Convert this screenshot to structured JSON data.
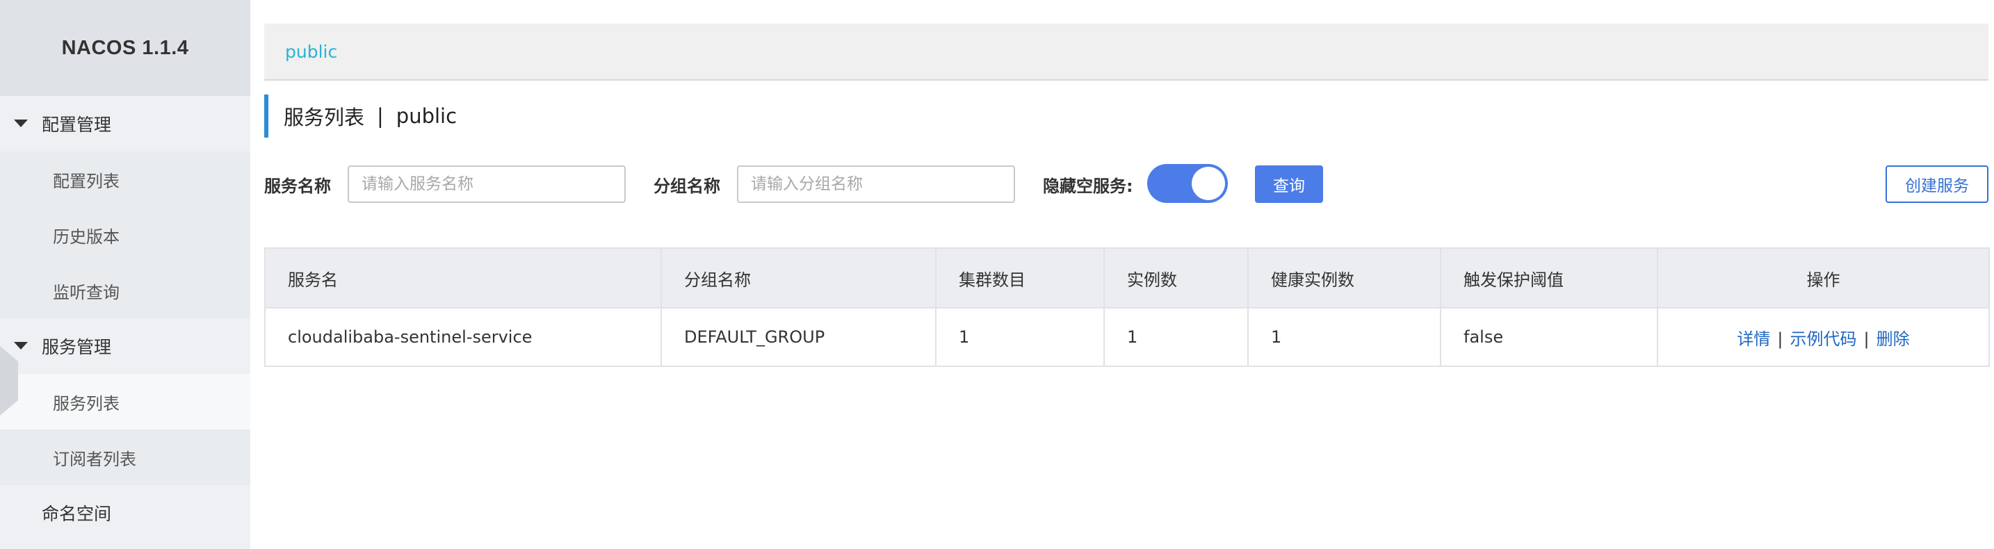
{
  "sidebar": {
    "brand": "NACOS 1.1.4",
    "groups": [
      {
        "label": "配置管理",
        "items": [
          "配置列表",
          "历史版本",
          "监听查询"
        ]
      },
      {
        "label": "服务管理",
        "items": [
          "服务列表",
          "订阅者列表"
        ]
      }
    ],
    "namespace": "命名空间",
    "active_item": "服务列表"
  },
  "breadcrumb": {
    "namespace": "public"
  },
  "page": {
    "title": "服务列表",
    "separator": "|",
    "namespace": "public"
  },
  "filters": {
    "service_name_label": "服务名称",
    "service_name_placeholder": "请输入服务名称",
    "service_name_value": "",
    "group_name_label": "分组名称",
    "group_name_placeholder": "请输入分组名称",
    "group_name_value": "",
    "hide_empty_label": "隐藏空服务:",
    "hide_empty_on": true,
    "query_label": "查询",
    "create_label": "创建服务"
  },
  "table": {
    "columns": [
      "服务名",
      "分组名称",
      "集群数目",
      "实例数",
      "健康实例数",
      "触发保护阈值",
      "操作"
    ],
    "rows": [
      {
        "service_name": "cloudalibaba-sentinel-service",
        "group_name": "DEFAULT_GROUP",
        "cluster_count": "1",
        "instance_count": "1",
        "healthy_instance_count": "1",
        "protect_threshold": "false",
        "actions": [
          "详情",
          "示例代码",
          "删除"
        ]
      }
    ],
    "action_separator": "|"
  },
  "colors": {
    "accent": "#4c7ce8",
    "link": "#1f66c2",
    "breadcrumb": "#2bb3d6",
    "title_bar": "#2a8dd8"
  },
  "icons": {
    "menu_group_caret": "caret-down-icon"
  }
}
